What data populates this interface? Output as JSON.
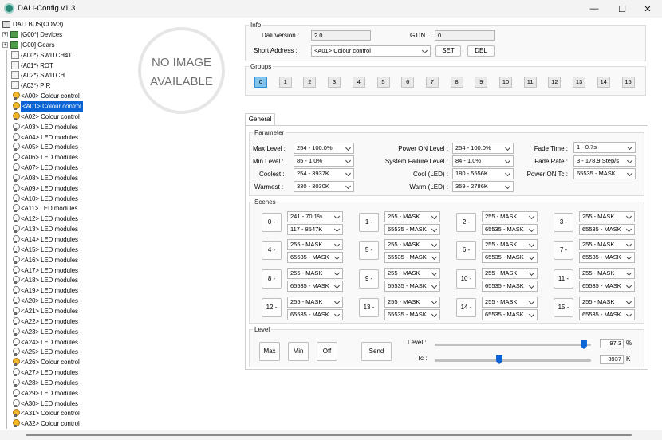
{
  "window": {
    "title": "DALI-Config v1.3",
    "min": "—",
    "max": "☐",
    "close": "✕"
  },
  "tree": {
    "root": "DALI BUS(COM3)",
    "nodes": [
      {
        "label": "[G00*] Devices",
        "kind": "group"
      },
      {
        "label": "[G00] Gears",
        "kind": "group"
      },
      {
        "label": "{A00*} SWITCH4T",
        "kind": "dev"
      },
      {
        "label": "{A01*} ROT",
        "kind": "dev"
      },
      {
        "label": "{A02*} SWITCH",
        "kind": "dev"
      },
      {
        "label": "{A03*} PIR",
        "kind": "dev"
      },
      {
        "label": "<A00> Colour control",
        "kind": "bulb"
      },
      {
        "label": "<A01> Colour control",
        "kind": "bulb",
        "selected": true
      },
      {
        "label": "<A02> Colour control",
        "kind": "bulb"
      },
      {
        "label": "<A03> LED modules",
        "kind": "mod"
      },
      {
        "label": "<A04> LED modules",
        "kind": "mod"
      },
      {
        "label": "<A05> LED modules",
        "kind": "mod"
      },
      {
        "label": "<A06> LED modules",
        "kind": "mod"
      },
      {
        "label": "<A07> LED modules",
        "kind": "mod"
      },
      {
        "label": "<A08> LED modules",
        "kind": "mod"
      },
      {
        "label": "<A09> LED modules",
        "kind": "mod"
      },
      {
        "label": "<A10> LED modules",
        "kind": "mod"
      },
      {
        "label": "<A11> LED modules",
        "kind": "mod"
      },
      {
        "label": "<A12> LED modules",
        "kind": "mod"
      },
      {
        "label": "<A13> LED modules",
        "kind": "mod"
      },
      {
        "label": "<A14> LED modules",
        "kind": "mod"
      },
      {
        "label": "<A15> LED modules",
        "kind": "mod"
      },
      {
        "label": "<A16> LED modules",
        "kind": "mod"
      },
      {
        "label": "<A17> LED modules",
        "kind": "mod"
      },
      {
        "label": "<A18> LED modules",
        "kind": "mod"
      },
      {
        "label": "<A19> LED modules",
        "kind": "mod"
      },
      {
        "label": "<A20> LED modules",
        "kind": "mod"
      },
      {
        "label": "<A21> LED modules",
        "kind": "mod"
      },
      {
        "label": "<A22> LED modules",
        "kind": "mod"
      },
      {
        "label": "<A23> LED modules",
        "kind": "mod"
      },
      {
        "label": "<A24> LED modules",
        "kind": "mod"
      },
      {
        "label": "<A25> LED modules",
        "kind": "mod"
      },
      {
        "label": "<A26> Colour control",
        "kind": "bulb"
      },
      {
        "label": "<A27> LED modules",
        "kind": "mod"
      },
      {
        "label": "<A28> LED modules",
        "kind": "mod"
      },
      {
        "label": "<A29> LED modules",
        "kind": "mod"
      },
      {
        "label": "<A30> LED modules",
        "kind": "mod"
      },
      {
        "label": "<A31> Colour control",
        "kind": "bulb"
      },
      {
        "label": "<A32> Colour control",
        "kind": "bulb"
      }
    ]
  },
  "image": {
    "line1": "NO IMAGE",
    "line2": "AVAILABLE"
  },
  "info": {
    "legend": "Info",
    "dali_version_label": "Dali Version :",
    "dali_version": "2.0",
    "gtin_label": "GTIN :",
    "gtin": "0",
    "short_address_label": "Short Address :",
    "short_address": "<A01> Colour control",
    "set": "SET",
    "del": "DEL"
  },
  "groups": {
    "legend": "Groups",
    "items": [
      "0",
      "1",
      "2",
      "3",
      "4",
      "5",
      "6",
      "7",
      "8",
      "9",
      "10",
      "11",
      "12",
      "13",
      "14",
      "15"
    ],
    "active": 0
  },
  "tabs": {
    "general": "General"
  },
  "parameter": {
    "legend": "Parameter",
    "max_level_label": "Max Level :",
    "max_level": "254 - 100.0%",
    "min_level_label": "Min Level :",
    "min_level": "85 - 1.0%",
    "coolest_label": "Coolest :",
    "coolest": "254 - 3937K",
    "warmest_label": "Warmest :",
    "warmest": "330 - 3030K",
    "power_on_level_label": "Power ON Level :",
    "power_on_level": "254 - 100.0%",
    "sys_fail_label": "System Failure Level :",
    "sys_fail": "84 - 1.0%",
    "cool_led_label": "Cool (LED) :",
    "cool_led": "180 - 5556K",
    "warm_led_label": "Warm (LED) :",
    "warm_led": "359 - 2786K",
    "fade_time_label": "Fade Time :",
    "fade_time": "1 - 0.7s",
    "fade_rate_label": "Fade Rate :",
    "fade_rate": "3 - 178.9 Step/s",
    "power_on_tc_label": "Power ON Tc :",
    "power_on_tc": "65535 - MASK"
  },
  "scenes": {
    "legend": "Scenes",
    "items": [
      {
        "btn": "0 -",
        "level": "241 - 70.1%",
        "tc": "117 - 8547K"
      },
      {
        "btn": "1 -",
        "level": "255 - MASK",
        "tc": "65535 - MASK"
      },
      {
        "btn": "2 -",
        "level": "255 - MASK",
        "tc": "65535 - MASK"
      },
      {
        "btn": "3 -",
        "level": "255 - MASK",
        "tc": "65535 - MASK"
      },
      {
        "btn": "4 -",
        "level": "255 - MASK",
        "tc": "65535 - MASK"
      },
      {
        "btn": "5 -",
        "level": "255 - MASK",
        "tc": "65535 - MASK"
      },
      {
        "btn": "6 -",
        "level": "255 - MASK",
        "tc": "65535 - MASK"
      },
      {
        "btn": "7 -",
        "level": "255 - MASK",
        "tc": "65535 - MASK"
      },
      {
        "btn": "8 -",
        "level": "255 - MASK",
        "tc": "65535 - MASK"
      },
      {
        "btn": "9 -",
        "level": "255 - MASK",
        "tc": "65535 - MASK"
      },
      {
        "btn": "10 -",
        "level": "255 - MASK",
        "tc": "65535 - MASK"
      },
      {
        "btn": "11 -",
        "level": "255 - MASK",
        "tc": "65535 - MASK"
      },
      {
        "btn": "12 -",
        "level": "255 - MASK",
        "tc": "65535 - MASK"
      },
      {
        "btn": "13 -",
        "level": "255 - MASK",
        "tc": "65535 - MASK"
      },
      {
        "btn": "14 -",
        "level": "255 - MASK",
        "tc": "65535 - MASK"
      },
      {
        "btn": "15 -",
        "level": "255 - MASK",
        "tc": "65535 - MASK"
      }
    ]
  },
  "level": {
    "legend": "Level",
    "max": "Max",
    "min": "Min",
    "off": "Off",
    "send": "Send",
    "level_label": "Level :",
    "level_value": "97.3",
    "level_unit": "%",
    "level_fraction": 0.973,
    "tc_label": "Tc :",
    "tc_value": "3937",
    "tc_unit": "K",
    "tc_fraction": 0.41
  },
  "colors": {
    "accent": "#0a64d6",
    "group_active": "#80c4ee"
  }
}
